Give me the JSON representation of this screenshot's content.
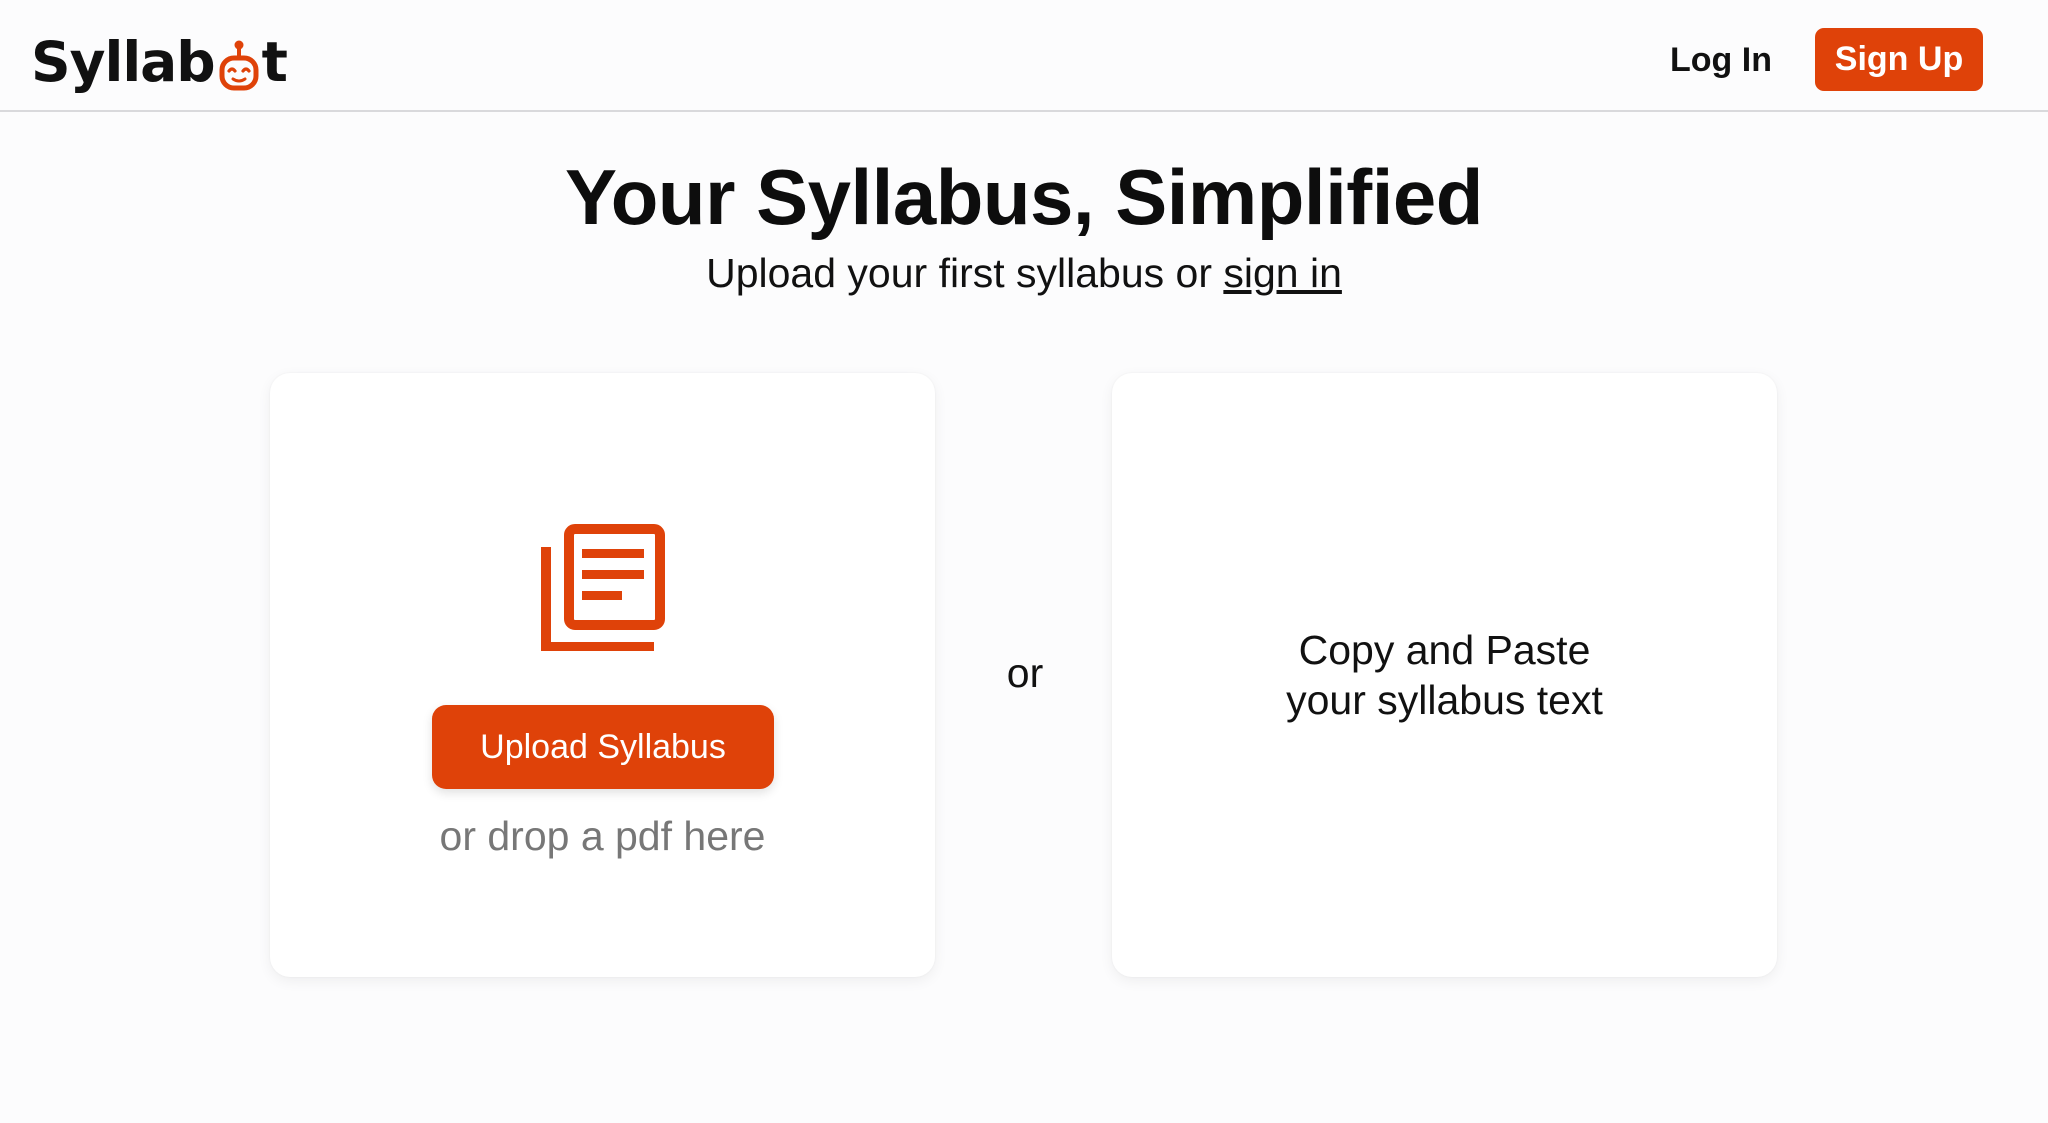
{
  "header": {
    "logo_prefix": "Syllab",
    "logo_suffix": "t",
    "login_label": "Log In",
    "signup_label": "Sign Up"
  },
  "hero": {
    "title": "Your Syllabus, Simplified",
    "subtitle_text": "Upload your first syllabus or ",
    "signin_link": "sign in"
  },
  "upload_card": {
    "icon": "documents-icon",
    "button_label": "Upload Syllabus",
    "drop_hint": "or drop a pdf here"
  },
  "separator": "or",
  "paste_card": {
    "line1": "Copy and Paste",
    "line2": "your syllabus text"
  },
  "colors": {
    "accent": "#df4209",
    "background": "#fcfcfd",
    "card": "#ffffff",
    "muted_text": "#777777"
  }
}
